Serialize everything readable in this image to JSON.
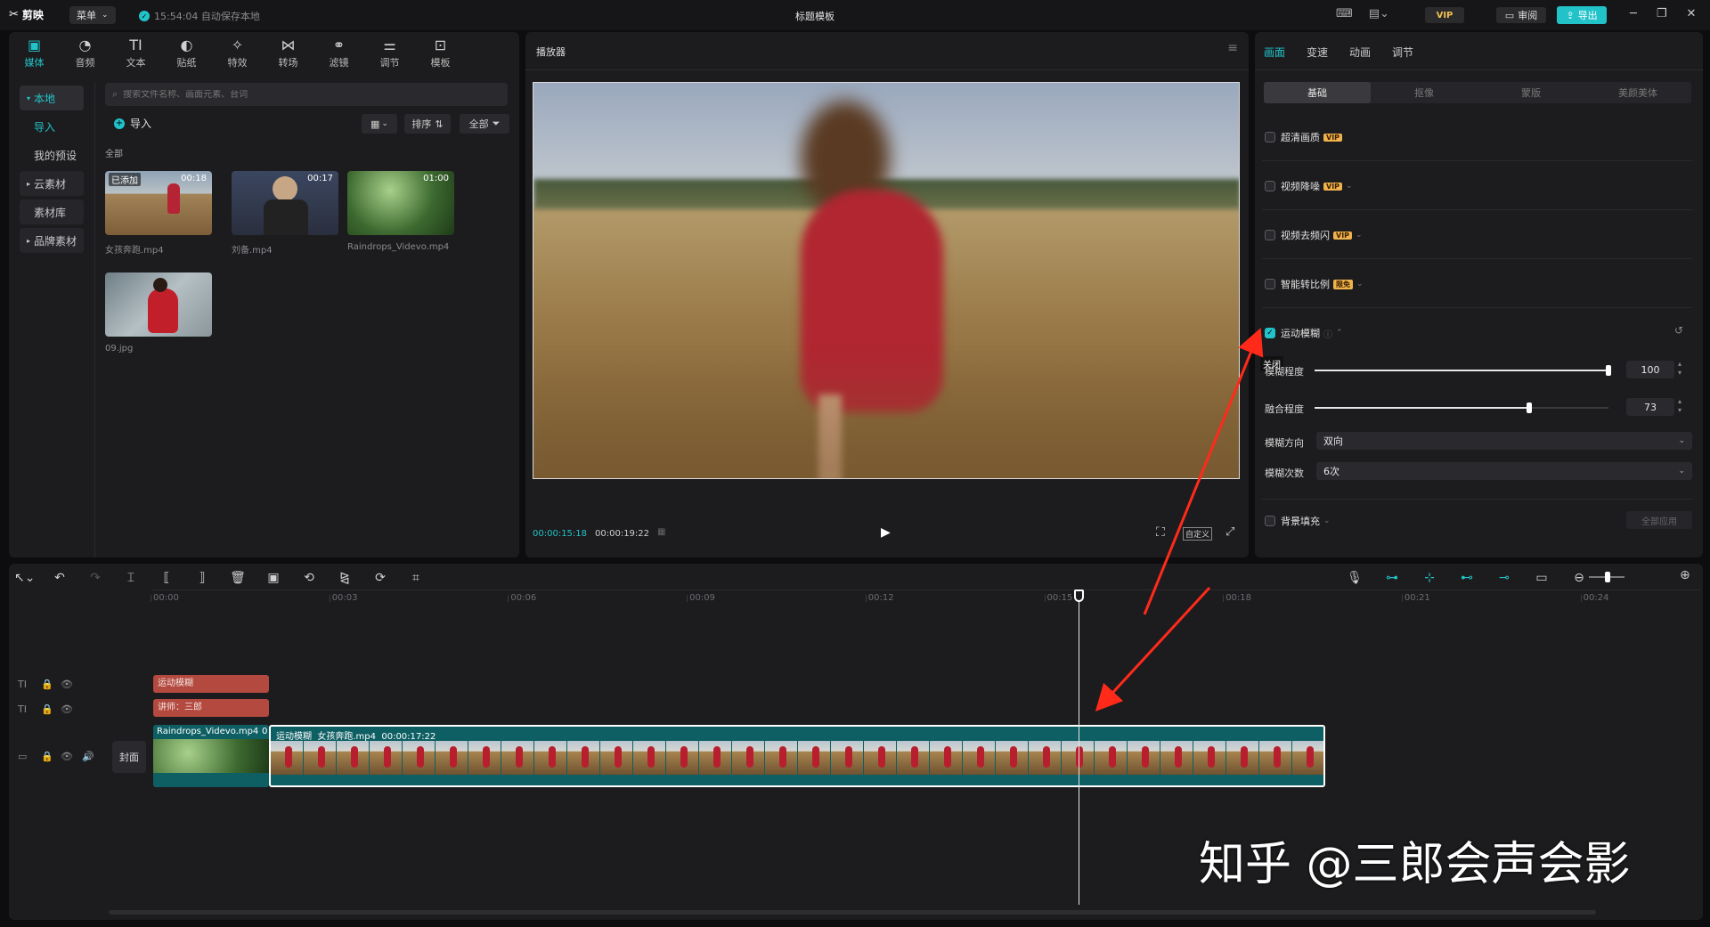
{
  "app": {
    "logo": "剪映",
    "menu_label": "菜单",
    "autosave": "15:54:04 自动保存本地",
    "title": "标题模板",
    "vip_label": "VIP",
    "review_label": "审阅",
    "export_label": "导出"
  },
  "media": {
    "tabs": [
      {
        "label": "媒体",
        "glyph": "▣"
      },
      {
        "label": "音频",
        "glyph": "◔"
      },
      {
        "label": "文本",
        "glyph": "TI"
      },
      {
        "label": "贴纸",
        "glyph": "◐"
      },
      {
        "label": "特效",
        "glyph": "✧"
      },
      {
        "label": "转场",
        "glyph": "⋈"
      },
      {
        "label": "滤镜",
        "glyph": "⚭"
      },
      {
        "label": "调节",
        "glyph": "⚌"
      },
      {
        "label": "模板",
        "glyph": "⊡"
      }
    ],
    "sidebar": [
      "本地",
      "导入",
      "我的预设",
      "云素材",
      "素材库",
      "品牌素材"
    ],
    "search_placeholder": "搜索文件名称、画面元素、台词",
    "import_label": "导入",
    "sort_label": "排序",
    "filter_label": "全部",
    "section_label": "全部",
    "items": [
      {
        "name": "女孩奔跑.mp4",
        "duration": "00:18",
        "badge": "已添加"
      },
      {
        "name": "刘备.mp4",
        "duration": "00:17",
        "badge": ""
      },
      {
        "name": "Raindrops_Videvo.mp4",
        "duration": "01:00",
        "badge": ""
      },
      {
        "name": "09.jpg",
        "duration": "",
        "badge": ""
      }
    ]
  },
  "player": {
    "title": "播放器",
    "current_time": "00:00:15:18",
    "total_time": "00:00:19:22",
    "custom_label": "自定义"
  },
  "inspector": {
    "tabs": [
      "画面",
      "变速",
      "动画",
      "调节"
    ],
    "subtabs": [
      "基础",
      "抠像",
      "蒙版",
      "美颜美体"
    ],
    "options": [
      {
        "label": "超清画质",
        "tag": "VIP"
      },
      {
        "label": "视频降噪",
        "tag": "VIP"
      },
      {
        "label": "视频去频闪",
        "tag": "VIP"
      },
      {
        "label": "智能转比例",
        "tag": "限免"
      },
      {
        "label": "运动模糊",
        "tag": ""
      }
    ],
    "tooltip": "关闭",
    "blur_label": "模糊程度",
    "blur_value": "100",
    "blur_fraction": 1.0,
    "blend_label": "融合程度",
    "blend_value": "73",
    "blend_fraction": 0.73,
    "direction_label": "模糊方向",
    "direction_value": "双向",
    "count_label": "模糊次数",
    "count_value": "6次",
    "bg_fill_label": "背景填充",
    "apply_all_label": "全部应用"
  },
  "timeline": {
    "ticks": [
      "00:00",
      "00:03",
      "00:06",
      "00:09",
      "00:12",
      "00:15",
      "00:18",
      "00:21",
      "00:24"
    ],
    "text_clip_1": "运动模糊",
    "text_clip_2": "讲师：三郎",
    "cover_label": "封面",
    "clip_a_label": "Raindrops_Videvo.mp4",
    "clip_a_extra": "0",
    "clip_b_label": "运动模糊  女孩奔跑.mp4  00:00:17:22"
  },
  "watermark": "知乎 @三郎会声会影",
  "colors": {
    "accent": "#21c3c9",
    "arrow": "#ff2a1a",
    "text_clip": "#b3493f",
    "video_clip": "#0e5f63"
  }
}
